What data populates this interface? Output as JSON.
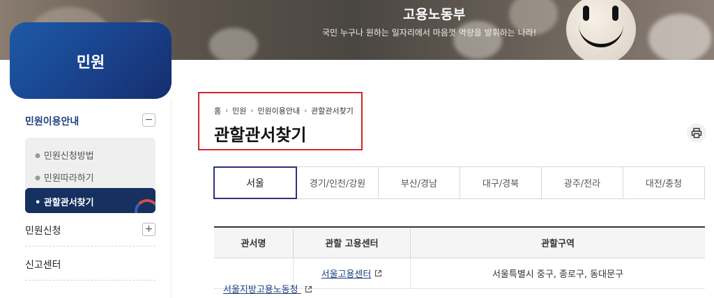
{
  "banner": {
    "title": "고용노동부",
    "subtitle": "국민 누구나 원하는 일자리에서 마음껏 역량을 발휘하는 나라!"
  },
  "sidebar": {
    "title": "민원",
    "menu": [
      {
        "label": "민원이용안내",
        "expanded": true,
        "toggle": "−"
      },
      {
        "label": "민원신청",
        "expanded": false,
        "toggle": "+"
      },
      {
        "label": "신고센터"
      }
    ],
    "sub_items": [
      {
        "label": "민원신청방법"
      },
      {
        "label": "민원따라하기"
      },
      {
        "label": "관할관서찾기",
        "active": true
      }
    ]
  },
  "breadcrumb": [
    "홈",
    "민원",
    "민원이용안내",
    "관할관서찾기"
  ],
  "page_title": "관할관서찾기",
  "tabs": [
    "서울",
    "경기/인천/강원",
    "부산/경남",
    "대구/경북",
    "광주/전라",
    "대전/충청"
  ],
  "active_tab": "서울",
  "table": {
    "headers": [
      "관서명",
      "관할 고용센터",
      "관할구역"
    ],
    "rows": [
      {
        "center": "서울고용센터",
        "area": "서울특별시 중구, 종로구, 동대문구"
      }
    ],
    "office": "서울지방고용노동청"
  },
  "colors": {
    "accent": "#1d3f80",
    "sidebar_gradient": "#1c5aa8",
    "active_sub": "#16305f",
    "highlight": "#d3262b",
    "active_tab_border": "#2d2f7d"
  },
  "icons": {
    "print": "print-icon",
    "external": "external-link-icon"
  }
}
